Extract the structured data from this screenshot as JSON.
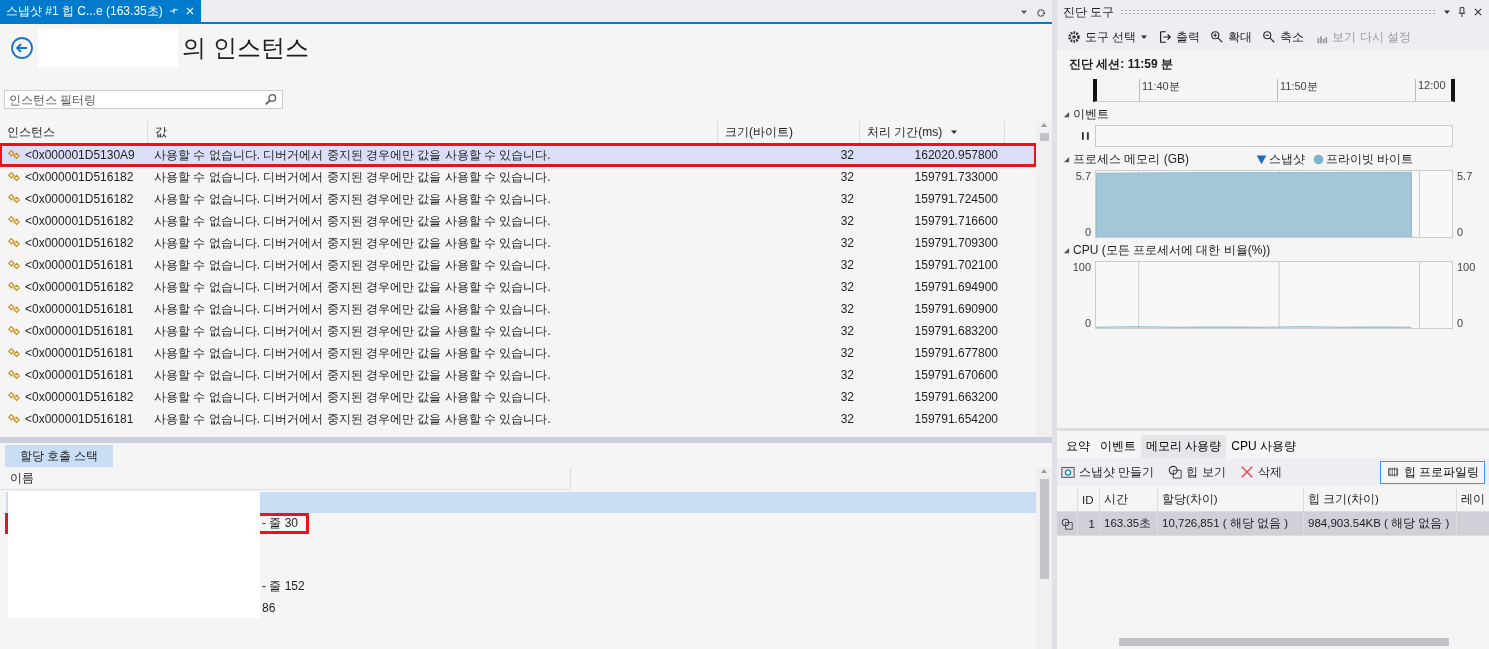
{
  "document_tab": {
    "title": "스냅샷 #1 힙 C...e (163.35초)",
    "selected": true
  },
  "header": {
    "title": "의 인스턴스"
  },
  "filter": {
    "placeholder": "인스턴스 필터링"
  },
  "instances": {
    "columns": [
      "인스턴스",
      "값",
      "크기(바이트)",
      "처리 기간(ms)"
    ],
    "rows": [
      {
        "instance": "<0x000001D5130A9",
        "value": "사용할 수 없습니다. 디버거에서 중지된 경우에만 값을 사용할 수 있습니다.",
        "size": "32",
        "duration": "162020.957800",
        "selected": true,
        "annotated": true
      },
      {
        "instance": "<0x000001D516182",
        "value": "사용할 수 없습니다. 디버거에서 중지된 경우에만 값을 사용할 수 있습니다.",
        "size": "32",
        "duration": "159791.733000",
        "selected": false,
        "annotated": false
      },
      {
        "instance": "<0x000001D516182",
        "value": "사용할 수 없습니다. 디버거에서 중지된 경우에만 값을 사용할 수 있습니다.",
        "size": "32",
        "duration": "159791.724500",
        "selected": false,
        "annotated": false
      },
      {
        "instance": "<0x000001D516182",
        "value": "사용할 수 없습니다. 디버거에서 중지된 경우에만 값을 사용할 수 있습니다.",
        "size": "32",
        "duration": "159791.716600",
        "selected": false,
        "annotated": false
      },
      {
        "instance": "<0x000001D516182",
        "value": "사용할 수 없습니다. 디버거에서 중지된 경우에만 값을 사용할 수 있습니다.",
        "size": "32",
        "duration": "159791.709300",
        "selected": false,
        "annotated": false
      },
      {
        "instance": "<0x000001D516181",
        "value": "사용할 수 없습니다. 디버거에서 중지된 경우에만 값을 사용할 수 있습니다.",
        "size": "32",
        "duration": "159791.702100",
        "selected": false,
        "annotated": false
      },
      {
        "instance": "<0x000001D516182",
        "value": "사용할 수 없습니다. 디버거에서 중지된 경우에만 값을 사용할 수 있습니다.",
        "size": "32",
        "duration": "159791.694900",
        "selected": false,
        "annotated": false
      },
      {
        "instance": "<0x000001D516181",
        "value": "사용할 수 없습니다. 디버거에서 중지된 경우에만 값을 사용할 수 있습니다.",
        "size": "32",
        "duration": "159791.690900",
        "selected": false,
        "annotated": false
      },
      {
        "instance": "<0x000001D516181",
        "value": "사용할 수 없습니다. 디버거에서 중지된 경우에만 값을 사용할 수 있습니다.",
        "size": "32",
        "duration": "159791.683200",
        "selected": false,
        "annotated": false
      },
      {
        "instance": "<0x000001D516181",
        "value": "사용할 수 없습니다. 디버거에서 중지된 경우에만 값을 사용할 수 있습니다.",
        "size": "32",
        "duration": "159791.677800",
        "selected": false,
        "annotated": false
      },
      {
        "instance": "<0x000001D516181",
        "value": "사용할 수 없습니다. 디버거에서 중지된 경우에만 값을 사용할 수 있습니다.",
        "size": "32",
        "duration": "159791.670600",
        "selected": false,
        "annotated": false
      },
      {
        "instance": "<0x000001D516182",
        "value": "사용할 수 없습니다. 디버거에서 중지된 경우에만 값을 사용할 수 있습니다.",
        "size": "32",
        "duration": "159791.663200",
        "selected": false,
        "annotated": false
      },
      {
        "instance": "<0x000001D516181",
        "value": "사용할 수 없습니다. 디버거에서 중지된 경우에만 값을 사용할 수 있습니다.",
        "size": "32",
        "duration": "159791.654200",
        "selected": false,
        "annotated": false
      }
    ]
  },
  "call_stack": {
    "tab": "할당 호출 스택",
    "columns": [
      "이름"
    ],
    "rows": [
      {
        "text": "",
        "selected": true,
        "annotated": false
      },
      {
        "text": "- 줄 30",
        "selected": false,
        "annotated": true
      },
      {
        "text": "",
        "selected": false,
        "annotated": false
      },
      {
        "text": "",
        "selected": false,
        "annotated": false
      },
      {
        "text": "- 줄 152",
        "selected": false,
        "annotated": false
      },
      {
        "text": "86",
        "selected": false,
        "annotated": false
      }
    ]
  },
  "diagnostics": {
    "title": "진단 도구",
    "toolbar": [
      {
        "label": "도구 선택",
        "kind": "gear",
        "disabled": false
      },
      {
        "label": "출력",
        "kind": "export",
        "disabled": false
      },
      {
        "label": "확대",
        "kind": "zoomin",
        "disabled": false
      },
      {
        "label": "축소",
        "kind": "zoomout",
        "disabled": false
      },
      {
        "label": "보기 다시 설정",
        "kind": "reset",
        "disabled": true
      }
    ],
    "session": "진단 세션: 11:59 분",
    "timeline": [
      "11:40분",
      "11:50분",
      "12:00"
    ],
    "events": {
      "title": "이벤트"
    },
    "memory": {
      "title": "프로세스 메모리 (GB)",
      "legend": [
        {
          "label": "스냅샷",
          "kind": "triangle",
          "color": "#1a6fc4"
        },
        {
          "label": "프라이빗 바이트",
          "kind": "circle",
          "color": "#7fb3cc"
        }
      ],
      "graph": {
        "kind": "area",
        "left_labels": [
          "5.7",
          "0"
        ],
        "right_labels": [
          "5.7",
          "0"
        ]
      }
    },
    "cpu": {
      "title": "CPU (모든 프로세서에 대한 비율(%))",
      "graph": {
        "kind": "line",
        "left_labels": [
          "100",
          "0"
        ],
        "right_labels": [
          "100",
          "0"
        ]
      }
    },
    "tabs": [
      {
        "label": "요약",
        "selected": false
      },
      {
        "label": "이벤트",
        "selected": false
      },
      {
        "label": "메모리 사용량",
        "selected": true
      },
      {
        "label": "CPU 사용량",
        "selected": false
      }
    ],
    "actions": [
      {
        "label": "스냅샷 만들기",
        "kind": "camera"
      },
      {
        "label": "힙 보기",
        "kind": "heap"
      },
      {
        "label": "삭제",
        "kind": "delete"
      }
    ],
    "heap_button": "힙 프로파일링",
    "snapshots": {
      "columns": [
        "ID",
        "시간",
        "할당(차이)",
        "힙 크기(차이)",
        "레이"
      ],
      "rows": [
        {
          "id": "1",
          "time": "163.35초",
          "alloc": "10,726,851 ( 해당 없음 )",
          "heap": "984,903.54KB ( 해당 없음 )",
          "selected": true
        }
      ]
    }
  }
}
